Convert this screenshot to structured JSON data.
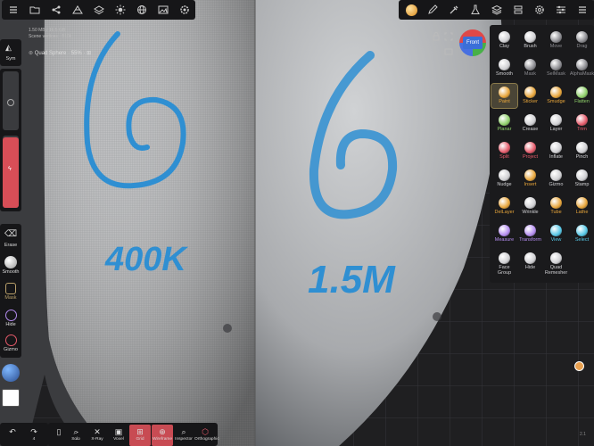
{
  "colors": {
    "accent": "#d84e57",
    "paint_active": "#e7a53a",
    "mask": "#c9a35a",
    "green": "#8fd06a",
    "cyan": "#55c7e6",
    "purple": "#b48cf0",
    "red": "#e55a6a"
  },
  "top_toolbar": {
    "left_icons": [
      "list-icon",
      "folder-icon",
      "share-icon",
      "mesh-icon",
      "layers-icon",
      "sun-icon",
      "globe-icon",
      "image-icon",
      "settings-icon"
    ],
    "right_icons": [
      "material-icon",
      "pen-icon",
      "eyedropper-icon",
      "flask-icon",
      "stack-icon",
      "gear-icon",
      "sliders-icon",
      "menu-icon"
    ]
  },
  "scene": {
    "stats_line1": "1.50 MB / 16.5 GB",
    "stats_line2": "Scene vertices · 810k",
    "name": "Quad Sphere · 55% · ⊞"
  },
  "gizmo": {
    "label": "Front"
  },
  "sym_label": "Sym",
  "left_tools": [
    {
      "label": "Erase",
      "icon": "eraser-icon"
    },
    {
      "label": "Smooth",
      "icon": "smooth-icon"
    },
    {
      "label": "Mask",
      "icon": "mask-icon"
    },
    {
      "label": "Hide",
      "icon": "hide-icon"
    },
    {
      "label": "Gizmo",
      "icon": "gizmo-icon"
    }
  ],
  "canvas": {
    "left_number": "6",
    "left_text": "400K",
    "right_number": "6",
    "right_text": "1.5M"
  },
  "tools": [
    {
      "label": "Clay",
      "icon": "clay-icon",
      "color": "#cfcfd2"
    },
    {
      "label": "Brush",
      "icon": "brush-icon",
      "color": "#cfcfd2"
    },
    {
      "label": "Move",
      "icon": "move-icon",
      "color": "#8a8a8f"
    },
    {
      "label": "Drag",
      "icon": "drag-icon",
      "color": "#8a8a8f"
    },
    {
      "label": "Smooth",
      "icon": "smooth-icon",
      "color": "#cfcfd2"
    },
    {
      "label": "Mask",
      "icon": "mask-icon",
      "color": "#8a8a8f"
    },
    {
      "label": "SelMask",
      "icon": "selmask-icon",
      "color": "#8a8a8f"
    },
    {
      "label": "AlphaMask",
      "icon": "alphamask-icon",
      "color": "#8a8a8f"
    },
    {
      "label": "Paint",
      "icon": "paint-icon",
      "color": "#e7a53a"
    },
    {
      "label": "Sticker",
      "icon": "sticker-icon",
      "color": "#e7a53a"
    },
    {
      "label": "Smudge",
      "icon": "smudge-icon",
      "color": "#e7a53a"
    },
    {
      "label": "Flatten",
      "icon": "flatten-icon",
      "color": "#8fd06a"
    },
    {
      "label": "Planar",
      "icon": "planar-icon",
      "color": "#8fd06a"
    },
    {
      "label": "Crease",
      "icon": "crease-icon",
      "color": "#cfcfd2"
    },
    {
      "label": "Layer",
      "icon": "layer-icon",
      "color": "#cfcfd2"
    },
    {
      "label": "Trim",
      "icon": "trim-icon",
      "color": "#e55a6a"
    },
    {
      "label": "Split",
      "icon": "split-icon",
      "color": "#e55a6a"
    },
    {
      "label": "Project",
      "icon": "project-icon",
      "color": "#e55a6a"
    },
    {
      "label": "Inflate",
      "icon": "inflate-icon",
      "color": "#cfcfd2"
    },
    {
      "label": "Pinch",
      "icon": "pinch-icon",
      "color": "#cfcfd2"
    },
    {
      "label": "Nudge",
      "icon": "nudge-icon",
      "color": "#cfcfd2"
    },
    {
      "label": "Insert",
      "icon": "insert-icon",
      "color": "#e7a53a"
    },
    {
      "label": "Gizmo",
      "icon": "gizmo-icon",
      "color": "#cfcfd2"
    },
    {
      "label": "Stamp",
      "icon": "stamp-icon",
      "color": "#cfcfd2"
    },
    {
      "label": "DelLayer",
      "icon": "dellayer-icon",
      "color": "#e7a53a"
    },
    {
      "label": "Wrinkle",
      "icon": "wrinkle-icon",
      "color": "#cfcfd2"
    },
    {
      "label": "Tube",
      "icon": "tube-icon",
      "color": "#e7a53a"
    },
    {
      "label": "Lathe",
      "icon": "lathe-icon",
      "color": "#e7a53a"
    },
    {
      "label": "Measure",
      "icon": "measure-icon",
      "color": "#b48cf0"
    },
    {
      "label": "Transform",
      "icon": "transform-icon",
      "color": "#b48cf0"
    },
    {
      "label": "View",
      "icon": "view-icon",
      "color": "#55c7e6"
    },
    {
      "label": "Select",
      "icon": "select-icon",
      "color": "#55c7e6"
    },
    {
      "label": "Face Group",
      "icon": "facegroup-icon",
      "color": "#cfcfd2"
    },
    {
      "label": "Hide",
      "icon": "hide-icon",
      "color": "#cfcfd2"
    },
    {
      "label": "Quad Remesher",
      "icon": "quad-remesher-icon",
      "color": "#cfcfd2"
    }
  ],
  "bottom": {
    "undo_label": "",
    "redo_label": "4",
    "buttons": [
      {
        "label": "",
        "icon": "document-icon"
      },
      {
        "label": "...",
        "icon": "dots-icon"
      },
      {
        "label": "Solo",
        "icon": "search-icon"
      },
      {
        "label": "X-Ray",
        "icon": "xray-icon"
      },
      {
        "label": "Voxel",
        "icon": "voxel-icon"
      },
      {
        "label": "Grid",
        "icon": "grid-icon"
      },
      {
        "label": "Wireframe",
        "icon": "wireframe-icon"
      },
      {
        "label": "Inspector",
        "icon": "inspector-icon"
      },
      {
        "label": "Orthographic",
        "icon": "cube-icon"
      }
    ]
  },
  "corner_label": "2.1"
}
